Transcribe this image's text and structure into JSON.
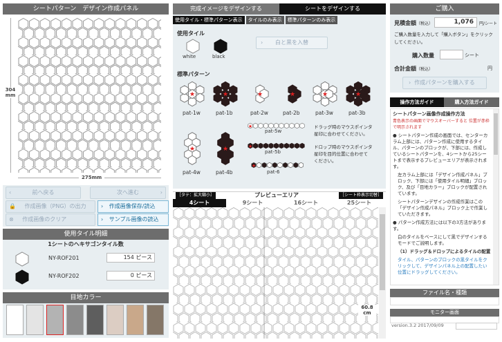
{
  "left": {
    "title": "シートパターン　デザイン作成パネル",
    "dim_height_value": "304",
    "dim_height_unit": "mm",
    "dim_width": "275mm",
    "undo_label": "前へ戻る",
    "redo_label": "次へ進む",
    "print_label": "作成画像（PNG）の出力",
    "save_label": "作成画像保存/読込",
    "clear_label": "作成画像のクリア",
    "sample_label": "サンプル画像の読込",
    "tiles_title": "使用タイル明細",
    "tiles_subtitle": "1シートのヘキサゴンタイル数",
    "tiles": [
      {
        "code": "NY-ROF201",
        "count": "154",
        "unit": "ピース",
        "color": "#ffffff"
      },
      {
        "code": "NY-ROF202",
        "count": "0",
        "unit": "ピース",
        "color": "#111111"
      }
    ],
    "grout_title": "目地カラー",
    "grout_colors": [
      "#ffffff",
      "#e4e4e4",
      "#b3b3b3",
      "#8c8c8c",
      "#5e5e5e",
      "#dccdc3",
      "#c9a88a",
      "#857768"
    ]
  },
  "center": {
    "tab_complete": "完成イメージをデザインする",
    "tab_sheet": "シートをデザインする",
    "subtab_1": "使用タイル・標準パターン表示",
    "subtab_2": "タイルのみ表示",
    "subtab_3": "標準パターンのみ表示",
    "used_tiles_label": "使用タイル",
    "tile_white": "white",
    "tile_black": "black",
    "swap_button": "白と黒を入替",
    "standard_patterns_label": "標準パターン",
    "patterns": [
      "pat-1w",
      "pat-1b",
      "pat-2w",
      "pat-2b",
      "pat-3w",
      "pat-3b",
      "pat-4w",
      "pat-4b"
    ],
    "pat_5w": "pat-5w",
    "pat_5b": "pat-5b",
    "pat_6": "pat-6",
    "drag_hint": "ドラッグ時のマウスポインタ\n星印に合わせてください。",
    "drop_hint": "ドロップ時のマウスポインタ\n星印を目的位置に合わせて\nください。",
    "preview_left_tag": "［タテ：拡大縮小］",
    "preview_title": "プレビューエリア",
    "preview_right_tag": "［シート枠表示切替］",
    "preview_tabs": [
      "4シート",
      "9シート",
      "16シート",
      "25シート"
    ],
    "preview_dim_value": "60.8",
    "preview_dim_unit": "cm"
  },
  "right": {
    "purchase_title": "ご購入",
    "estimate_label": "見積金額",
    "tax_label": "（税込）",
    "estimate_value": "1,076",
    "estimate_unit": "円/シート",
    "purchase_note": "ご購入数量を入力して「購入ボタン」をクリックしてください。",
    "qty_label": "購入数量",
    "qty_unit": "シート",
    "total_label": "合計金額",
    "total_tax": "（税込）",
    "total_unit": "円",
    "buy_button": "作成パターンを購入する",
    "tab_guide": "操作方法ガイド",
    "tab_purchase": "購入方法ガイド",
    "guide_title": "シートパターン画像作成操作方法",
    "guide_red": "青色表示の画面でマウスオーバーすると 位置が赤枠で明示されます",
    "guide_items": [
      "シートパターン作成の画面では、センターカラム上部には、パターン作成に使用するタイル、パターンのブロックが、下部には、作成しているシートパターンを、4シートから25シートまで表示するプレビューエリアが表示されます。",
      "左カラム上部には「デザイン作成パネル」ブロック、下部には「使用タイル明細」ブロック、及び「目地カラー」ブロックが配置されています。",
      "シートパターンデザインの作成作業はこの「デザイン作成パネル」ブロック上で作業していただきます。",
      "パターン作成方法には以下の3方法があります。",
      "白のタイルをベースにして黒でデザインするモードでご説明します。",
      "（1）ドラッグ＆ドロップによるタイルの配置",
      "タイル、パターンのブロックの黒タイルをクリックして、デザインパネル上の配置したい位置にドラッグしてください。"
    ],
    "file_title": "ファイル名・種類",
    "monitor_title": "モニター画面",
    "version": "version.3.2 2017/09/09"
  }
}
